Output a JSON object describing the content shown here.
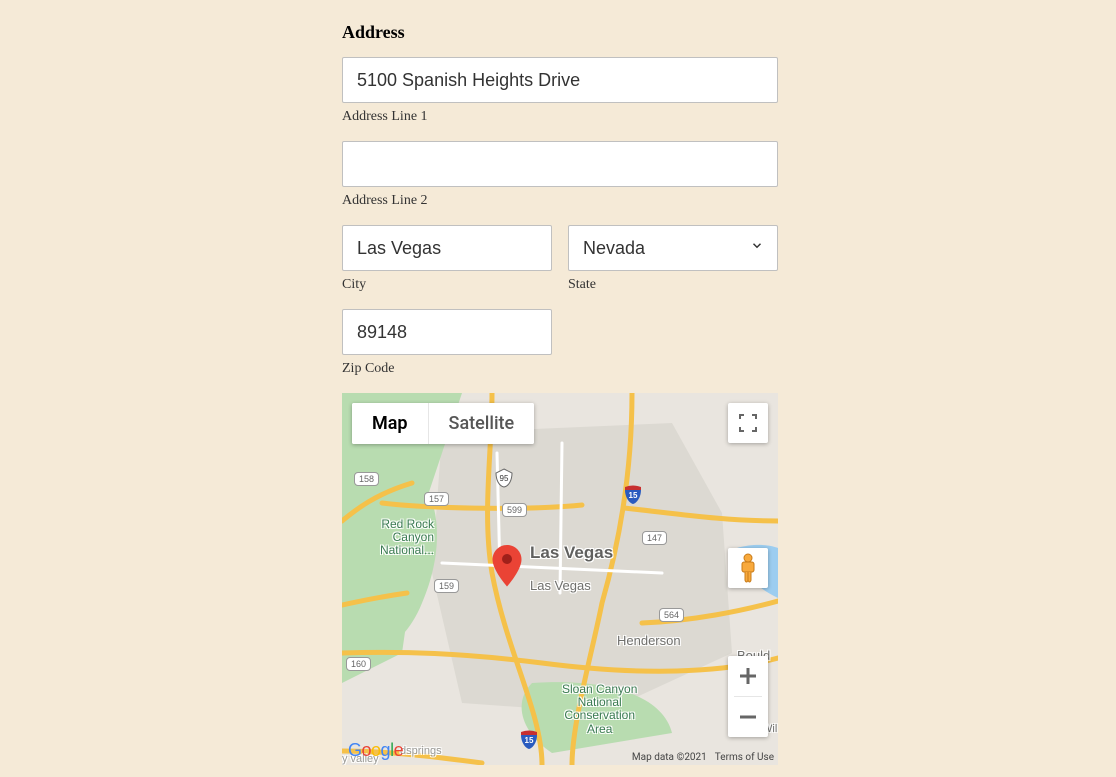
{
  "form": {
    "heading": "Address",
    "address_line1": {
      "label": "Address Line 1",
      "value": "5100 Spanish Heights Drive"
    },
    "address_line2": {
      "label": "Address Line 2",
      "value": ""
    },
    "city": {
      "label": "City",
      "value": "Las Vegas"
    },
    "state": {
      "label": "State",
      "value": "Nevada"
    },
    "zip": {
      "label": "Zip Code",
      "value": "89148"
    }
  },
  "map": {
    "type_map": "Map",
    "type_satellite": "Satellite",
    "credits_data": "Map data ©2021",
    "credits_terms": "Terms of Use",
    "labels": {
      "las_vegas_major": "Las Vegas",
      "las_vegas_minor": "Las Vegas",
      "henderson": "Henderson",
      "boulder": "Bould",
      "valley_partial": "y valley",
      "red_rock": "Red Rock\nCanyon\nNational...",
      "sloan_canyon": "Sloan Canyon\nNational\nConservation\nArea",
      "goodsprings": "dsprings",
      "wil_partial": "Wil"
    },
    "highways": {
      "h158": "158",
      "h157": "157",
      "h159": "159",
      "h160": "160",
      "h599": "599",
      "h147": "147",
      "h564": "564",
      "h95": "95",
      "h15a": "15",
      "h15b": "15"
    }
  }
}
